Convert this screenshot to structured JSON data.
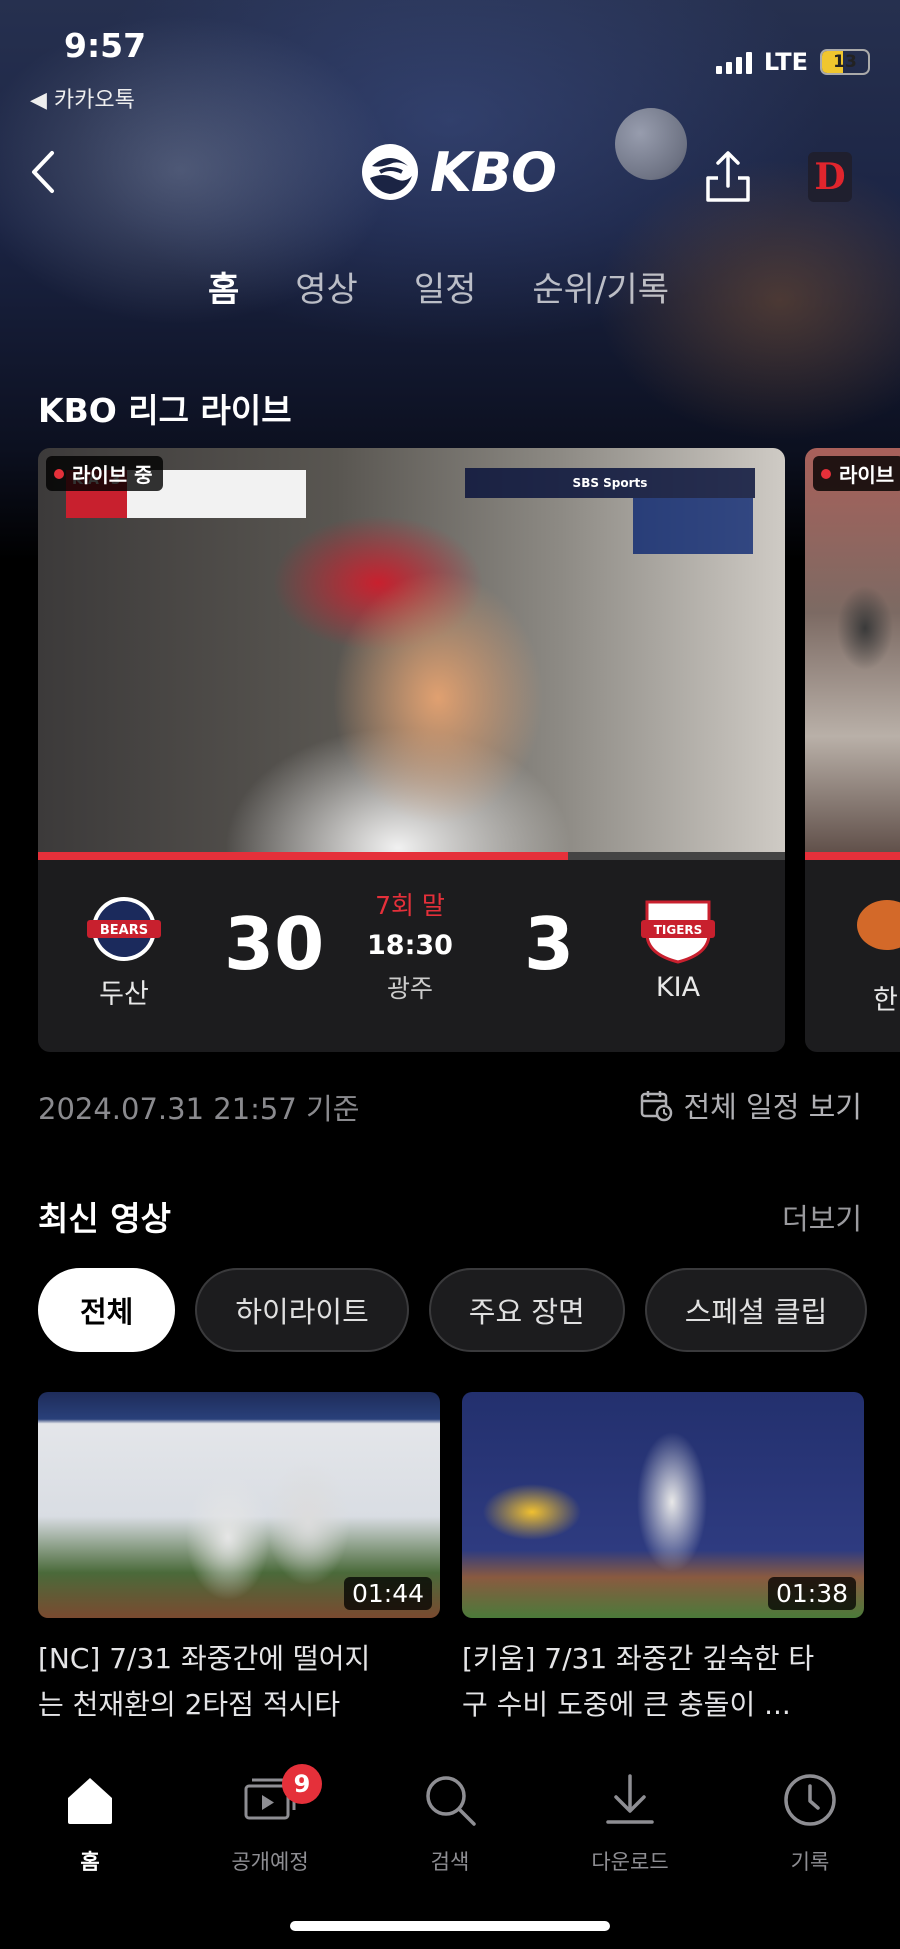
{
  "status_bar": {
    "time": "9:57",
    "back_app": "◀ 카카오톡",
    "network": "LTE",
    "battery": "13"
  },
  "header": {
    "logo_text": "KBO"
  },
  "tabs": [
    {
      "label": "홈",
      "active": true
    },
    {
      "label": "영상",
      "active": false
    },
    {
      "label": "일정",
      "active": false
    },
    {
      "label": "순위/기록",
      "active": false
    }
  ],
  "live": {
    "section_title": "KBO 리그 라이브",
    "badge": "라이브 중",
    "badge_second": "라이브",
    "overlay_team": "KIA",
    "overlay_score": "3",
    "broadcaster": "SBS Sports",
    "progress": 0.71,
    "game": {
      "home_team": "두산",
      "home_logo": "BEARS",
      "home_score": "30",
      "away_team": "KIA",
      "away_logo": "TIGERS",
      "away_score": "3",
      "inning": "7회 말",
      "time": "18:30",
      "stadium": "광주"
    },
    "next_team_partial": "한"
  },
  "updated_at": "2024.07.31 21:57 기준",
  "schedule_link": "전체 일정 보기",
  "videos": {
    "section_title": "최신 영상",
    "more": "더보기",
    "filters": [
      {
        "label": "전체",
        "active": true
      },
      {
        "label": "하이라이트",
        "active": false
      },
      {
        "label": "주요 장면",
        "active": false
      },
      {
        "label": "스페셜 클립",
        "active": false
      }
    ],
    "items": [
      {
        "duration": "01:44",
        "title_line1": "[NC] 7/31 좌중간에 떨어지",
        "title_line2": "는 천재환의 2타점 적시타"
      },
      {
        "duration": "01:38",
        "title_line1": "[키움] 7/31 좌중간 깊숙한 타",
        "title_line2": "구 수비 도중에 큰 충돌이 ..."
      }
    ]
  },
  "bottom_nav": [
    {
      "label": "홈",
      "icon": "home-icon",
      "active": true
    },
    {
      "label": "공개예정",
      "icon": "upcoming-icon",
      "badge": "9"
    },
    {
      "label": "검색",
      "icon": "search-icon"
    },
    {
      "label": "다운로드",
      "icon": "download-icon"
    },
    {
      "label": "기록",
      "icon": "history-icon"
    }
  ],
  "colors": {
    "accent": "#e5303a",
    "background": "#000000",
    "card": "#1c1c1e"
  }
}
